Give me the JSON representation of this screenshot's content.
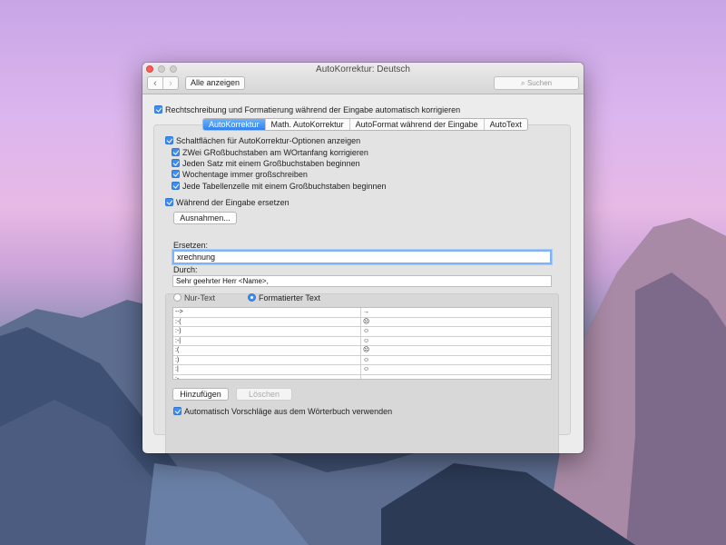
{
  "window": {
    "title": "AutoKorrektur: Deutsch",
    "show_all": "Alle anzeigen",
    "search_placeholder": "Suchen",
    "nav_back": "‹",
    "nav_forward": "›",
    "search_icon": "magnifier"
  },
  "spelling_option": "Rechtschreibung und Formatierung während der Eingabe automatisch korrigieren",
  "tabs": [
    {
      "label": "AutoKorrektur",
      "active": true
    },
    {
      "label": "Math. AutoKorrektur",
      "active": false
    },
    {
      "label": "AutoFormat während der Eingabe",
      "active": false
    },
    {
      "label": "AutoText",
      "active": false
    }
  ],
  "options": {
    "show_buttons": "Schaltflächen für AutoKorrektur-Optionen anzeigen",
    "two_caps": "ZWei GRoßbuchstaben am WOrtanfang korrigieren",
    "sentence_caps": "Jeden Satz mit einem Großbuchstaben beginnen",
    "weekdays": "Wochentage immer großschreiben",
    "table_cells": "Jede Tabellenzelle mit einem Großbuchstaben beginnen",
    "replace_while_typing": "Während der Eingabe ersetzen"
  },
  "exceptions_button": "Ausnahmen...",
  "replace": {
    "label": "Ersetzen:",
    "value": "xrechnung",
    "with_label": "Durch:",
    "with_value": "Sehr geehrter Herr <Name>,",
    "plain_text": "Nur-Text",
    "formatted_text": "Formatierter Text"
  },
  "entries": [
    {
      "from": "-->",
      "to": "→"
    },
    {
      "from": ":-(",
      "to": "☹"
    },
    {
      "from": ":-)",
      "to": "☺"
    },
    {
      "from": ":-|",
      "to": "☺"
    },
    {
      "from": ":(",
      "to": "☹"
    },
    {
      "from": ":)",
      "to": "☺"
    },
    {
      "from": ":|",
      "to": "☺"
    },
    {
      "from": ":-",
      "to": ""
    }
  ],
  "add_button": "Hinzufügen",
  "delete_button": "Löschen",
  "dictionary_option": "Automatisch Vorschläge aus dem Wörterbuch verwenden",
  "colors": {
    "accent": "#3d8df5",
    "close": "#fc5f57"
  }
}
